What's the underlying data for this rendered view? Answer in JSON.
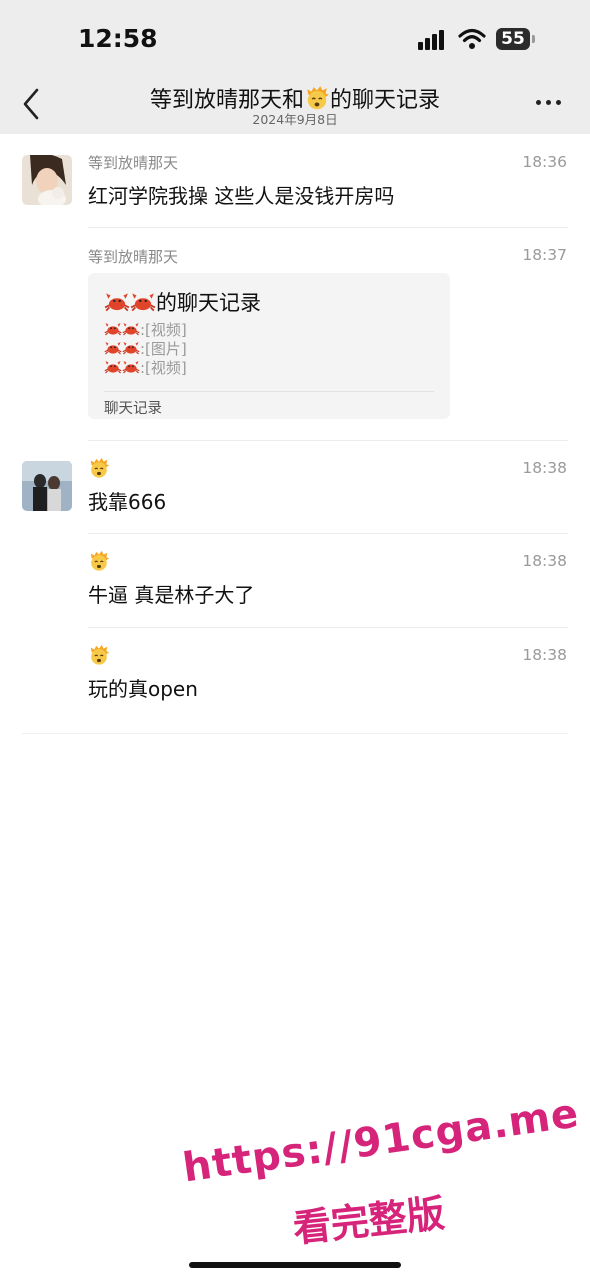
{
  "status_bar": {
    "time": "12:58",
    "battery": "55"
  },
  "header": {
    "title_prefix": "等到放晴那天和",
    "title_suffix": "的聊天记录",
    "title_emoji": "exploding-head-emoji",
    "subtitle": "2024年9月8日",
    "back_icon": "chevron-left-icon",
    "more_icon": "more-dots-icon"
  },
  "messages": [
    {
      "sender": "等到放晴那天",
      "time": "18:36",
      "text": "红河学院我操 这些人是没钱开房吗"
    },
    {
      "sender": "等到放晴那天",
      "time": "18:37",
      "card": {
        "title_suffix": "的聊天记录",
        "lines": [
          ":[视频]",
          ":[图片]",
          ":[视频]"
        ],
        "footer": "聊天记录"
      }
    },
    {
      "sender_emoji": "exploding-head-emoji",
      "time": "18:38",
      "text": "我靠666"
    },
    {
      "sender_emoji": "exploding-head-emoji",
      "time": "18:38",
      "text": "牛逼 真是林子大了"
    },
    {
      "sender_emoji": "exploding-head-emoji",
      "time": "18:38",
      "text": "玩的真open"
    }
  ],
  "watermark": {
    "url": "https://91cga.me",
    "caption": "看完整版"
  },
  "colors": {
    "header_bg": "#ededed",
    "watermark": "#d6247a",
    "card_bg": "#f4f4f4"
  }
}
